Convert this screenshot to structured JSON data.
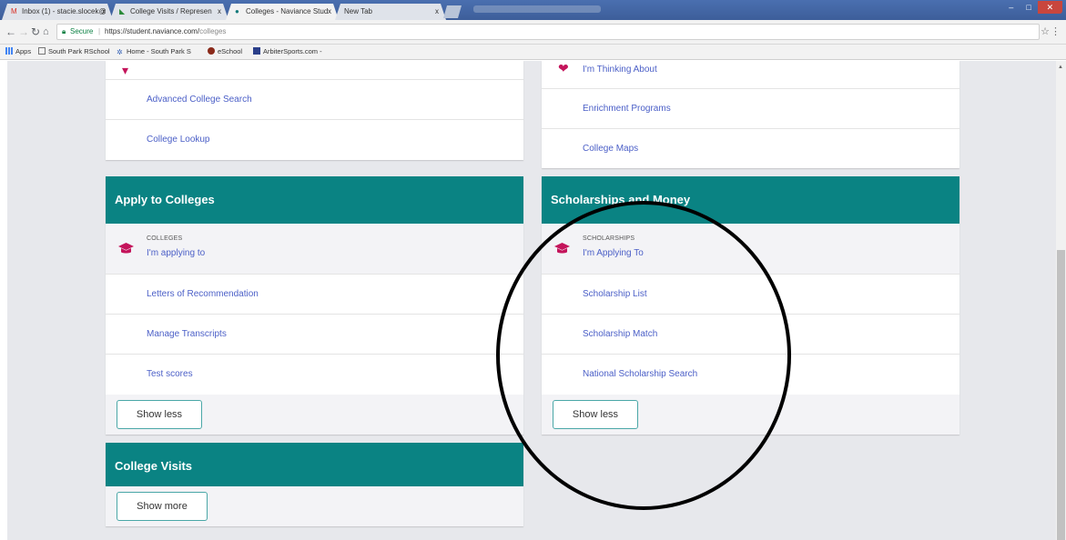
{
  "browser": {
    "tabs": [
      {
        "title": "Inbox (1) - stacie.slocek@",
        "icon": "gmail-icon",
        "active": false
      },
      {
        "title": "College Visits / Represen",
        "icon": "naviance-icon",
        "active": false
      },
      {
        "title": "Colleges - Naviance Stud",
        "icon": "naviance-globe-icon",
        "active": true
      },
      {
        "title": "New Tab",
        "icon": "",
        "active": false
      }
    ],
    "security_label": "Secure",
    "url_host": "https://student.naviance.com/",
    "url_path": "colleges",
    "bookmarks": [
      "Apps",
      "South Park RSchool",
      "Home - South Park S",
      "eSchool",
      "ArbiterSports.com -"
    ]
  },
  "top_left_card": {
    "rows": [
      "Advanced College Search",
      "College Lookup"
    ]
  },
  "top_right_card": {
    "rows": [
      "I'm Thinking About",
      "Enrichment Programs",
      "College Maps"
    ]
  },
  "apply_card": {
    "title": "Apply to Colleges",
    "feature_caption": "COLLEGES",
    "feature_link": "I'm applying to",
    "rows": [
      "Letters of Recommendation",
      "Manage Transcripts",
      "Test scores"
    ],
    "button": "Show less"
  },
  "scholarships_card": {
    "title": "Scholarships and Money",
    "feature_caption": "SCHOLARSHIPS",
    "feature_link": "I'm Applying To",
    "rows": [
      "Scholarship List",
      "Scholarship Match",
      "National Scholarship Search"
    ],
    "button": "Show less"
  },
  "visits_card": {
    "title": "College Visits",
    "button": "Show more"
  },
  "colors": {
    "header_teal": "#0a8383",
    "link_blue": "#4b5fc7",
    "icon_crimson": "#c4145b",
    "annotation": "#000000"
  }
}
